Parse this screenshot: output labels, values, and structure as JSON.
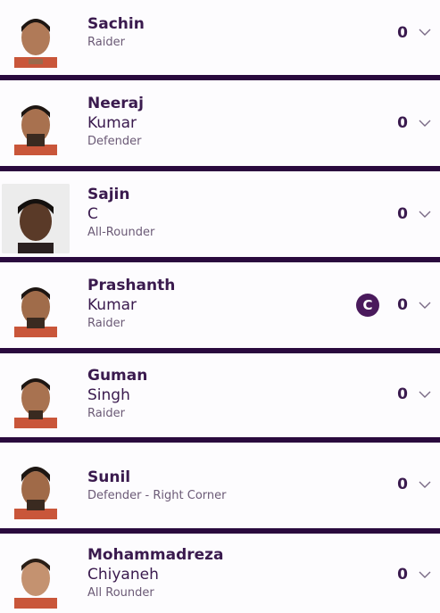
{
  "players": [
    {
      "first_name": "Sachin",
      "last_name": "",
      "role": "Raider",
      "points": "0",
      "captain": false,
      "avatar": "player-photo"
    },
    {
      "first_name": "Neeraj",
      "last_name": "Kumar",
      "role": "Defender",
      "points": "0",
      "captain": false,
      "avatar": "player-photo"
    },
    {
      "first_name": "Sajin",
      "last_name": "C",
      "role": "All-Rounder",
      "points": "0",
      "captain": false,
      "avatar": "player-photo"
    },
    {
      "first_name": "Prashanth",
      "last_name": "Kumar",
      "role": "Raider",
      "points": "0",
      "captain": true,
      "captain_label": "C",
      "avatar": "player-photo"
    },
    {
      "first_name": "Guman",
      "last_name": "Singh",
      "role": "Raider",
      "points": "0",
      "captain": false,
      "avatar": "player-photo"
    },
    {
      "first_name": "Sunil",
      "last_name": "",
      "role": "Defender - Right Corner",
      "points": "0",
      "captain": false,
      "avatar": "player-photo"
    },
    {
      "first_name": "Mohammadreza",
      "last_name": "Chiyaneh",
      "role": "All Rounder",
      "points": "0",
      "captain": false,
      "avatar": "player-photo"
    }
  ],
  "icons": {
    "expand": "chevron-down-icon",
    "captain": "captain-badge"
  },
  "colors": {
    "divider": "#2a0a3e",
    "text": "#3a1a4e",
    "captain_bg": "#4a1a5c",
    "row_bg": "#fdfcfe"
  }
}
